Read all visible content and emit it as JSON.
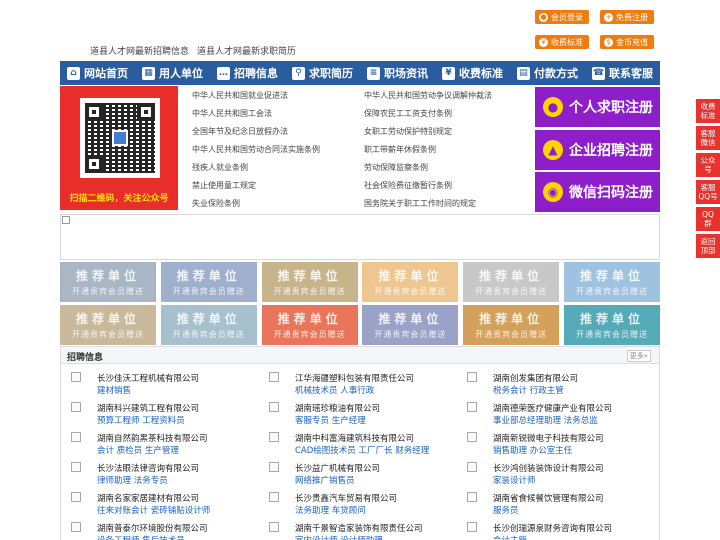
{
  "top_links": [
    "道县人才网最新招聘信息",
    "道县人才网最新求职简历"
  ],
  "top_buttons": {
    "member_login": "会员登录",
    "register_free": "免费注册",
    "fee_standard": "收费标准",
    "gold_recharge": "金币充值"
  },
  "nav": [
    "网站首页",
    "用人单位",
    "招聘信息",
    "求职简历",
    "职场资讯",
    "收费标准",
    "付款方式",
    "联系客服"
  ],
  "qr_caption": "扫描二维码，关注公众号",
  "laws_left": [
    "中华人民共和国就业促进法",
    "中华人民共和国工会法",
    "全国年节及纪念日放假办法",
    "中华人民共和国劳动合同法实施条例",
    "残疾人就业条例",
    "禁止使用童工规定",
    "失业保险条例"
  ],
  "laws_right": [
    "中华人民共和国劳动争议调解仲裁法",
    "保障农民工工资支付条例",
    "女职工劳动保护特别规定",
    "职工带薪年休假条例",
    "劳动保障监察条例",
    "社会保险费征缴暂行条例",
    "国务院关于职工工作时间的规定"
  ],
  "big_buttons": [
    "个人求职注册",
    "企业招聘注册",
    "微信扫码注册"
  ],
  "recommend": {
    "title": "推荐单位",
    "sub": "开通贵宾会员赠送",
    "colors": [
      "#a9b6c6",
      "#9fb0cc",
      "#c7b48b",
      "#eec68f",
      "#c8c8c8",
      "#9fc2e0",
      "#c9b99a",
      "#a7c0ce",
      "#e9765b",
      "#9aa2c8",
      "#d3a15b",
      "#55aab7"
    ]
  },
  "jobs": {
    "section_title": "招聘信息",
    "more": "更多»",
    "items": [
      {
        "company": "长沙佳沃工程机械有限公司",
        "positions": "建材销售"
      },
      {
        "company": "江华海疆塑料包装有限责任公司",
        "positions": "机械技术员 人事行政"
      },
      {
        "company": "湖南创发集团有限公司",
        "positions": "税务会计 行政主管"
      },
      {
        "company": "湖南科兴建筑工程有限公司",
        "positions": "预算工程师 工程资料员"
      },
      {
        "company": "湖南瑶珍粮油有限公司",
        "positions": "客服专员 生产经理"
      },
      {
        "company": "湖南德荣医疗健康产业有限公司",
        "positions": "事业部总经理助理 法务总监"
      },
      {
        "company": "湖南自然韵黑茶科技有限公司",
        "positions": "会计 质检员 生产管理"
      },
      {
        "company": "湖南中科富海建筑科技有限公司",
        "positions": "CAD绘图技术员 工厂厂长 财务经理"
      },
      {
        "company": "湖南新锐微电子科技有限公司",
        "positions": "销售助理 办公室主任"
      },
      {
        "company": "长沙法眼法律咨询有限公司",
        "positions": "律师助理 法务专员"
      },
      {
        "company": "长沙益广机械有限公司",
        "positions": "网络推广销售员"
      },
      {
        "company": "长沙鸿创装装饰设计有限公司",
        "positions": "家装设计师"
      },
      {
        "company": "湖南名家家居建材有限公司",
        "positions": "往来对账会计 瓷砖铺贴设计师"
      },
      {
        "company": "长沙贵鑫汽车贸易有限公司",
        "positions": "法务助理 车贷顾问"
      },
      {
        "company": "湖南省食候餐饮管理有限公司",
        "positions": "服务员"
      },
      {
        "company": "湖南普泰尔环境股份有限公司",
        "positions": "设备工程师 售后技术员"
      },
      {
        "company": "湖南千景智造家装饰有限责任公司",
        "positions": "室内设计师 设计师助理"
      },
      {
        "company": "长沙创瑞源泉财务咨询有限公司",
        "positions": "会计主管"
      }
    ]
  },
  "side": [
    "收费\n标准",
    "客服\n微信",
    "公众\n号",
    "客服\nQQ号",
    "QQ\n群",
    "返回\n顶部"
  ]
}
